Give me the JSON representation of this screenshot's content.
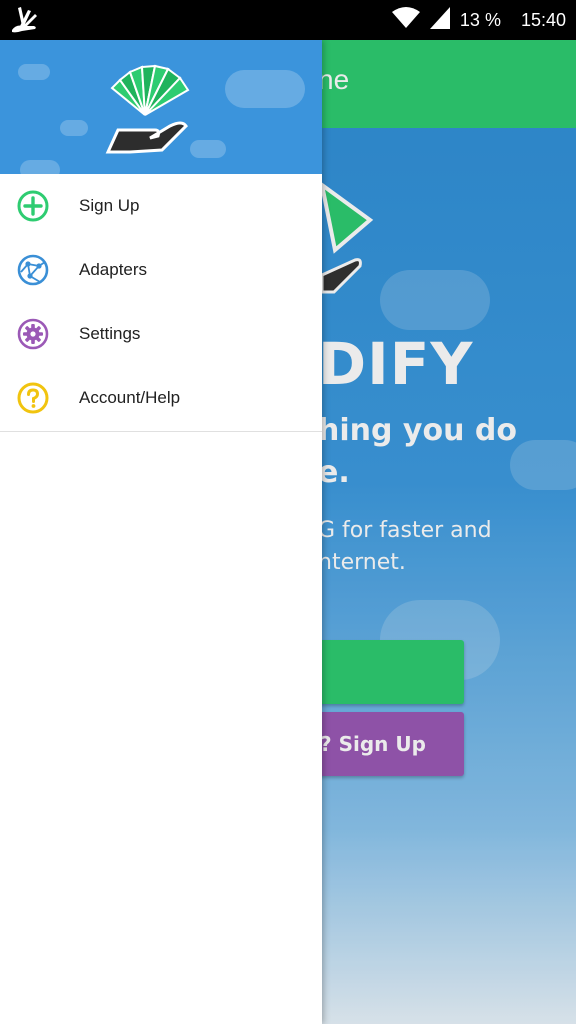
{
  "status_bar": {
    "battery": "13 %",
    "time": "15:40",
    "icons": [
      "app-logo-icon",
      "wifi-icon",
      "signal-icon",
      "battery-icon"
    ]
  },
  "background_app": {
    "toolbar_title_fragment": "ne",
    "brand_fragment": "DIFY",
    "tagline_fragment": "hing you do\ne.",
    "description_fragment": "G for faster and\nnternet.",
    "button_fragment": "? Sign Up",
    "colors": {
      "toolbar": "#2ecc71",
      "purple_button": "#9b59b6"
    }
  },
  "drawer": {
    "header_logo": "hand-fan-logo",
    "header_color": "#3b94dc",
    "items": [
      {
        "label": "Sign Up",
        "icon": "plus-circle-icon",
        "color": "#2ecc71"
      },
      {
        "label": "Adapters",
        "icon": "network-globe-icon",
        "color": "#3a8fd6"
      },
      {
        "label": "Settings",
        "icon": "gear-icon",
        "color": "#9b59b6"
      },
      {
        "label": "Account/Help",
        "icon": "help-circle-icon",
        "color": "#f1c40f"
      }
    ]
  }
}
